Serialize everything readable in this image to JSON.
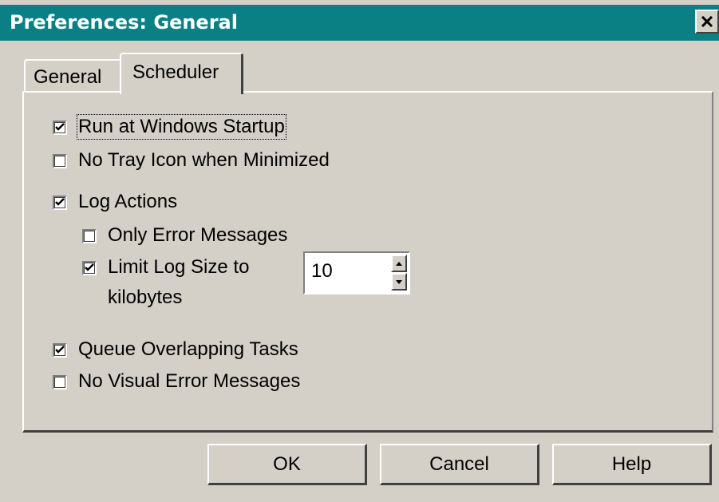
{
  "window": {
    "title": "Preferences: General"
  },
  "tabs": [
    {
      "label": "General",
      "selected": false
    },
    {
      "label": "Scheduler",
      "selected": true
    }
  ],
  "options": {
    "run_at_startup": {
      "label": "Run at Windows Startup",
      "checked": true
    },
    "no_tray_icon": {
      "label": "No Tray Icon when Minimized",
      "checked": false
    },
    "log_actions": {
      "label": "Log Actions",
      "checked": true
    },
    "only_error_messages": {
      "label": "Only Error Messages",
      "checked": false
    },
    "limit_log_size": {
      "label_line1": "Limit Log Size to",
      "label_line2": "kilobytes",
      "checked": true,
      "value": "10"
    },
    "queue_overlapping": {
      "label": "Queue Overlapping Tasks",
      "checked": true
    },
    "no_visual_errors": {
      "label": "No Visual Error Messages",
      "checked": false
    }
  },
  "buttons": {
    "ok": "OK",
    "cancel": "Cancel",
    "help": "Help"
  },
  "colors": {
    "title_bar": "#0a7f84",
    "face": "#d4d0c8"
  }
}
